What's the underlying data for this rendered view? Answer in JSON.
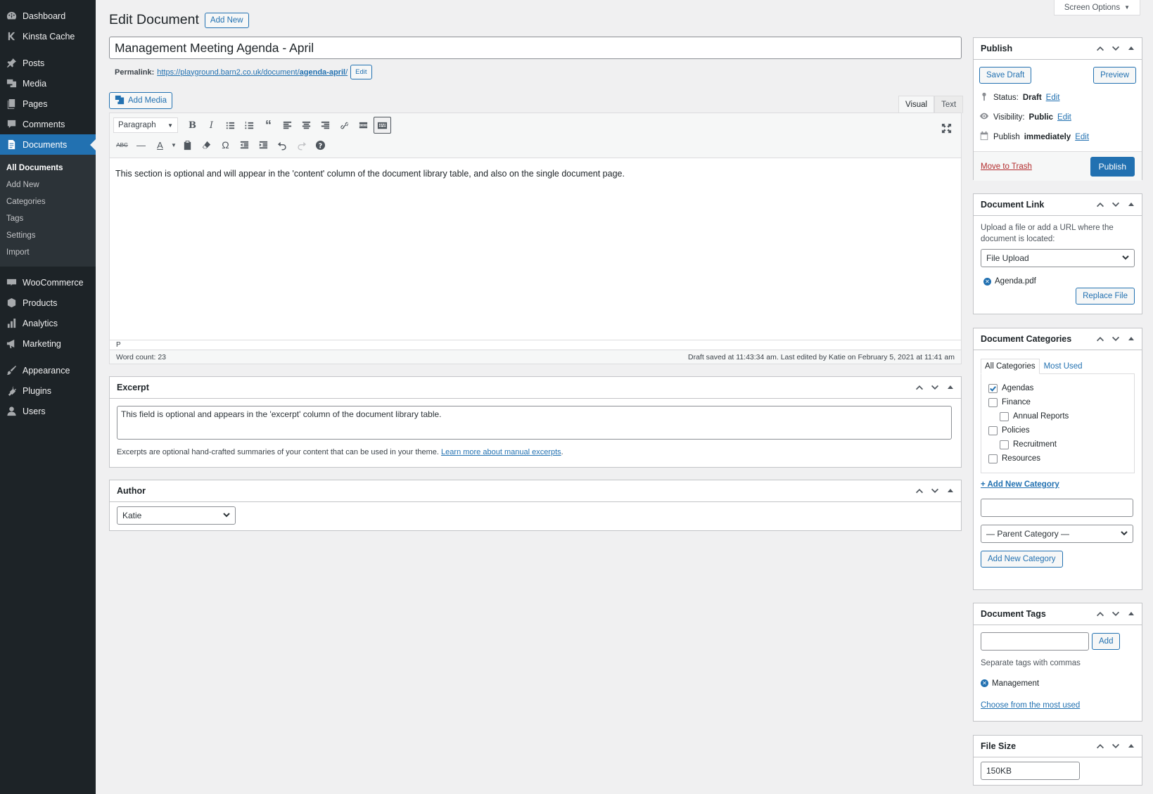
{
  "sidebar": {
    "items_top": [
      {
        "label": "Dashboard",
        "icon": "dashboard-icon"
      },
      {
        "label": "Kinsta Cache",
        "icon": "kinsta-icon"
      }
    ],
    "items_content": [
      {
        "label": "Posts",
        "icon": "pin-icon"
      },
      {
        "label": "Media",
        "icon": "media-icon"
      },
      {
        "label": "Pages",
        "icon": "pages-icon"
      },
      {
        "label": "Comments",
        "icon": "comments-icon"
      },
      {
        "label": "Documents",
        "icon": "document-icon"
      }
    ],
    "submenu": [
      "All Documents",
      "Add New",
      "Categories",
      "Tags",
      "Settings",
      "Import"
    ],
    "items_woo": [
      {
        "label": "WooCommerce",
        "icon": "woo-icon"
      },
      {
        "label": "Products",
        "icon": "products-icon"
      },
      {
        "label": "Analytics",
        "icon": "analytics-icon"
      },
      {
        "label": "Marketing",
        "icon": "megaphone-icon"
      }
    ],
    "items_bottom": [
      {
        "label": "Appearance",
        "icon": "brush-icon"
      },
      {
        "label": "Plugins",
        "icon": "plugin-icon"
      },
      {
        "label": "Users",
        "icon": "user-icon"
      }
    ]
  },
  "header": {
    "screen_options": "Screen Options",
    "title": "Edit Document",
    "add_new": "Add New"
  },
  "post": {
    "title": "Management Meeting Agenda - April",
    "permalink_label": "Permalink:",
    "permalink_base": "https://playground.barn2.co.uk/document/",
    "permalink_slug": "agenda-april",
    "permalink_trail": "/",
    "permalink_edit": "Edit"
  },
  "editor": {
    "add_media": "Add Media",
    "tab_visual": "Visual",
    "tab_text": "Text",
    "format": "Paragraph",
    "content": "This section is optional and will appear in the 'content' column of the document library table, and also on the single document page.",
    "path": "P",
    "word_count": "Word count: 23",
    "draft_saved": "Draft saved at 11:43:34 am. Last edited by Katie on February 5, 2021 at 11:41 am"
  },
  "excerpt": {
    "title": "Excerpt",
    "value": "This field is optional and appears in the 'excerpt' column of the document library table.",
    "help": "Excerpts are optional hand-crafted summaries of your content that can be used in your theme.",
    "help_link": "Learn more about manual excerpts",
    "help_end": "."
  },
  "author": {
    "title": "Author",
    "selected": "Katie"
  },
  "publish": {
    "title": "Publish",
    "save_draft": "Save Draft",
    "preview": "Preview",
    "status_label": "Status:",
    "status_value": "Draft",
    "visibility_label": "Visibility:",
    "visibility_value": "Public",
    "publish_label": "Publish",
    "publish_value": "immediately",
    "edit": "Edit",
    "trash": "Move to Trash",
    "publish_btn": "Publish"
  },
  "doc_link": {
    "title": "Document Link",
    "desc": "Upload a file or add a URL where the document is located:",
    "select": "File Upload",
    "file": "Agenda.pdf",
    "replace": "Replace File"
  },
  "categories": {
    "title": "Document Categories",
    "tab_all": "All Categories",
    "tab_used": "Most Used",
    "items": [
      {
        "label": "Agendas",
        "checked": true,
        "child": false
      },
      {
        "label": "Finance",
        "checked": false,
        "child": false
      },
      {
        "label": "Annual Reports",
        "checked": false,
        "child": true
      },
      {
        "label": "Policies",
        "checked": false,
        "child": false
      },
      {
        "label": "Recruitment",
        "checked": false,
        "child": true
      },
      {
        "label": "Resources",
        "checked": false,
        "child": false
      }
    ],
    "add_link": "+ Add New Category",
    "parent_select": "— Parent Category —",
    "add_btn": "Add New Category"
  },
  "tags": {
    "title": "Document Tags",
    "add": "Add",
    "help": "Separate tags with commas",
    "tag": "Management",
    "choose": "Choose from the most used"
  },
  "file_size": {
    "title": "File Size",
    "value": "150KB"
  },
  "colors": {
    "accent": "#2271b1",
    "sidebar_bg": "#1d2327",
    "trash": "#b32d2e"
  }
}
